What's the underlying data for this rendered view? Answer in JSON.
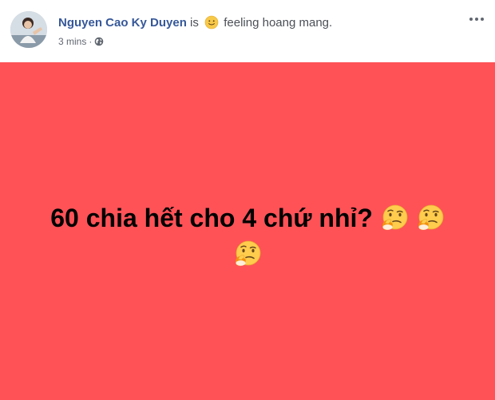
{
  "post": {
    "author": "Nguyen Cao Ky Duyen",
    "is_text": "is",
    "feeling_text": "feeling hoang mang.",
    "feeling_icon": "slightly-smiling-face-icon",
    "time": "3 mins",
    "separator": "·",
    "privacy_icon": "globe-icon",
    "options_icon": "more-options-icon"
  },
  "status": {
    "text": "60 chia hết cho 4 chứ nhỉ?",
    "emoji_icon": "thinking-face-icon",
    "emoji_count": 3,
    "background_color": "#fe5257",
    "text_color": "#000000"
  }
}
